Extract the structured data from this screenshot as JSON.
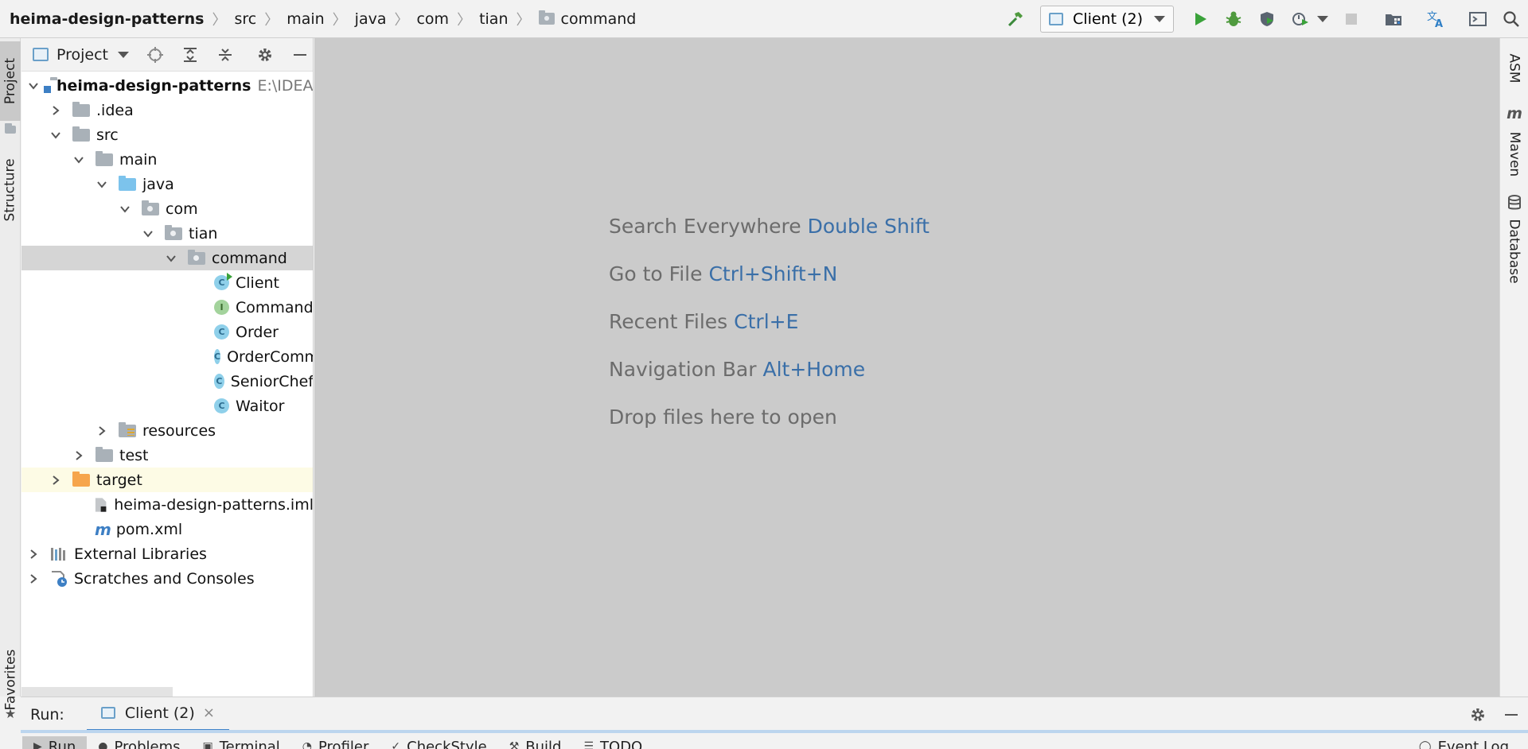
{
  "breadcrumb": [
    "heima-design-patterns",
    "src",
    "main",
    "java",
    "com",
    "tian",
    "command"
  ],
  "toolbar": {
    "run_config": "Client (2)"
  },
  "left_tabs": {
    "project": "Project",
    "structure": "Structure",
    "favorites": "Favorites"
  },
  "right_tabs": {
    "asm": "ASM",
    "maven": "Maven",
    "database": "Database"
  },
  "project_panel": {
    "title": "Project",
    "root_name": "heima-design-patterns",
    "root_path": "E:\\IDEACo",
    "items": [
      {
        "label": ".idea"
      },
      {
        "label": "src"
      },
      {
        "label": "main"
      },
      {
        "label": "java"
      },
      {
        "label": "com"
      },
      {
        "label": "tian"
      },
      {
        "label": "command"
      },
      {
        "label": "Client"
      },
      {
        "label": "Command"
      },
      {
        "label": "Order"
      },
      {
        "label": "OrderComm"
      },
      {
        "label": "SeniorChef"
      },
      {
        "label": "Waitor"
      },
      {
        "label": "resources"
      },
      {
        "label": "test"
      },
      {
        "label": "target"
      },
      {
        "label": "heima-design-patterns.iml"
      },
      {
        "label": "pom.xml"
      },
      {
        "label": "External Libraries"
      },
      {
        "label": "Scratches and Consoles"
      }
    ]
  },
  "editor_hints": [
    {
      "text": "Search Everywhere",
      "key": "Double Shift"
    },
    {
      "text": "Go to File",
      "key": "Ctrl+Shift+N"
    },
    {
      "text": "Recent Files",
      "key": "Ctrl+E"
    },
    {
      "text": "Navigation Bar",
      "key": "Alt+Home"
    },
    {
      "text": "Drop files here to open",
      "key": ""
    }
  ],
  "run_panel": {
    "label": "Run:",
    "tab": "Client (2)",
    "close": "×"
  },
  "bottom_tabs": [
    "Run",
    "Problems",
    "Terminal",
    "Profiler",
    "CheckStyle",
    "Build",
    "TODO",
    "Event Log"
  ]
}
